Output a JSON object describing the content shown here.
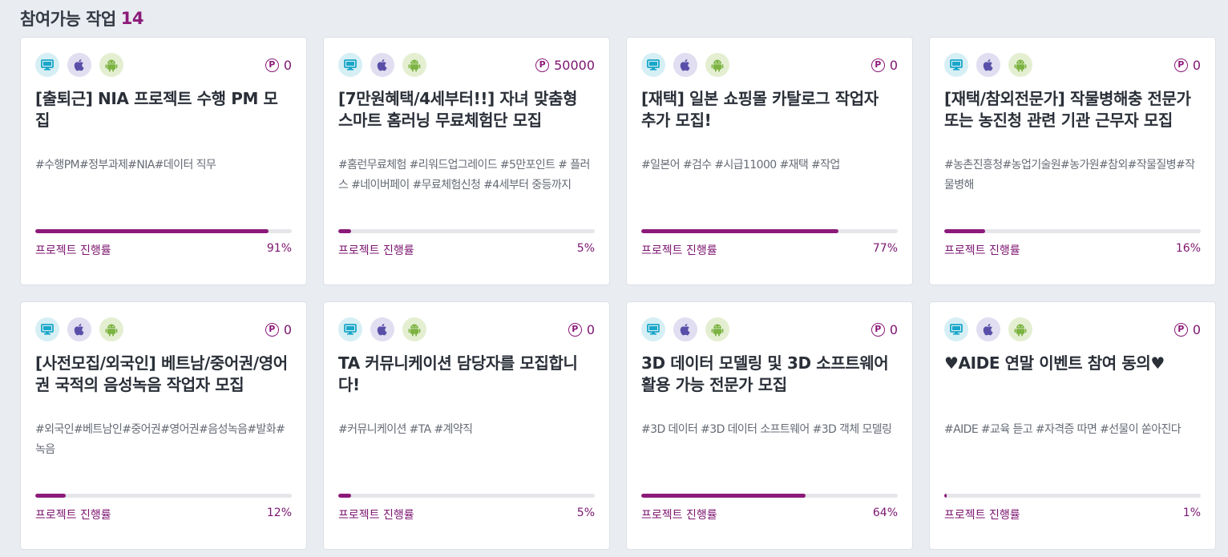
{
  "header": {
    "title": "참여가능 작업",
    "count": "14"
  },
  "colors": {
    "accent": "#8c1a7a",
    "pc_icon": "#1aa6c9",
    "ios_icon": "#5a4fa8",
    "android_icon": "#8cc63f"
  },
  "icons": [
    "monitor-icon",
    "apple-icon",
    "android-icon",
    "point-icon"
  ],
  "progress_label": "프로젝트 진행률",
  "point_symbol": "P",
  "cards": [
    {
      "points": "0",
      "title": "[출퇴근] NIA 프로젝트 수행 PM 모집",
      "tags": "#수행PM#정부과제#NIA#데이터 직무",
      "progress": 91,
      "progress_text": "91%"
    },
    {
      "points": "50000",
      "title": "[7만원혜택/4세부터!!] 자녀 맞춤형 스마트 홈러닝 무료체험단 모집",
      "tags": "#홈런무료체험 #리워드업그레이드 #5만포인트 # 플러스 #네이버페이 #무료체험신청 #4세부터 중등까지",
      "progress": 5,
      "progress_text": "5%"
    },
    {
      "points": "0",
      "title": "[재택] 일본 쇼핑몰 카탈로그 작업자 추가 모집!",
      "tags": "#일본어 #검수 #시급11000 #재택 #작업",
      "progress": 77,
      "progress_text": "77%"
    },
    {
      "points": "0",
      "title": "[재택/참외전문가] 작물병해충 전문가 또는 농진청 관련 기관 근무자 모집",
      "tags": "#농촌진흥청#농업기술원#농가원#참외#작물질병#작물병해",
      "progress": 16,
      "progress_text": "16%"
    },
    {
      "points": "0",
      "title": "[사전모집/외국인] 베트남/중어권/영어권 국적의 음성녹음 작업자 모집",
      "tags": "#외국인#베트남인#중어권#영어권#음성녹음#발화#녹음",
      "progress": 12,
      "progress_text": "12%"
    },
    {
      "points": "0",
      "title": "TA 커뮤니케이션 담당자를 모집합니다!",
      "tags": "#커뮤니케이션 #TA #계약직",
      "progress": 5,
      "progress_text": "5%"
    },
    {
      "points": "0",
      "title": "3D 데이터 모델링 및 3D 소프트웨어 활용 가능 전문가 모집",
      "tags": "#3D 데이터 #3D 데이터 소프트웨어 #3D 객체 모델링",
      "progress": 64,
      "progress_text": "64%"
    },
    {
      "points": "0",
      "title": "♥AIDE 연말 이벤트 참여 동의♥",
      "tags": "#AIDE #교육 듣고 #자격증 따면 #선물이 쏟아진다",
      "progress": 1,
      "progress_text": "1%"
    }
  ]
}
